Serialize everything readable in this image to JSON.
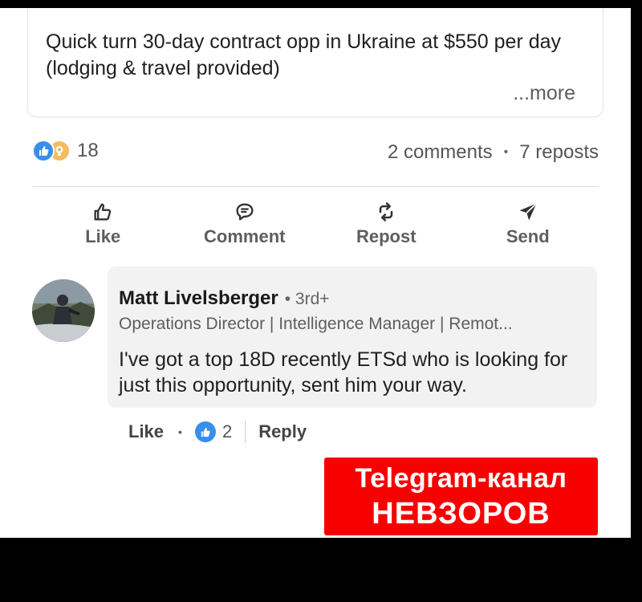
{
  "post": {
    "text": "Quick turn 30-day contract opp in Ukraine at $550 per day\n(lodging & travel provided)",
    "more_label": "...more"
  },
  "stats": {
    "reaction_icons": [
      "like-icon",
      "insightful-icon"
    ],
    "reaction_count": "18",
    "comments": "2 comments",
    "separator": "•",
    "reposts": "7 reposts"
  },
  "actions": [
    {
      "label": "Like",
      "icon": "thumbs-up-icon"
    },
    {
      "label": "Comment",
      "icon": "comment-icon"
    },
    {
      "label": "Repost",
      "icon": "repost-icon"
    },
    {
      "label": "Send",
      "icon": "send-icon"
    }
  ],
  "comment": {
    "author": "Matt Livelsberger",
    "degree": "• 3rd+",
    "headline": "Operations Director | Intelligence Manager | Remot...",
    "text": "I've got a top 18D recently ETSd who is looking for just this opportunity, sent him your way.",
    "like_label": "Like",
    "separator": "•",
    "reaction_count": "2",
    "reply_label": "Reply"
  },
  "watermark": {
    "line1": "Telegram-канал",
    "line2": "НЕВЗОРОВ"
  },
  "colors": {
    "accent": "#378fe9",
    "watermark_bg": "#f90000",
    "page_bg": "#000000"
  }
}
